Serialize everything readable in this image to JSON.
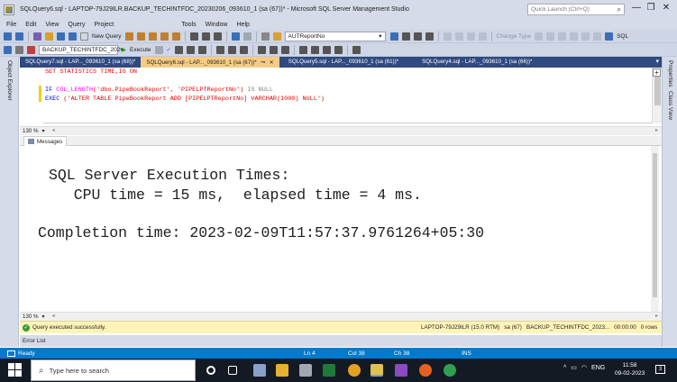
{
  "window": {
    "title": "SQLQuery6.sql - LAPTOP-79J29ILR.BACKUP_TECHINTFDC_20230206_093610_1 (sa (67))* - Microsoft SQL Server Management Studio",
    "quick_launch_placeholder": "Quick Launch (Ctrl+Q)",
    "minimize": "—",
    "maximize": "❐",
    "close": "✕"
  },
  "menu": [
    "File",
    "Edit",
    "View",
    "Query",
    "Project",
    "Tools",
    "Window",
    "Help"
  ],
  "toolbar1": {
    "new_query": "New Query",
    "object_combo": "AUTReportNo",
    "change_type": "Change Type",
    "sql_label": "SQL"
  },
  "toolbar2": {
    "database": "BACKUP_TECHINTFDC_202",
    "execute": "Execute"
  },
  "side": {
    "left": "Object Explorer",
    "right_properties": "Properties",
    "right_class_view": "Class View"
  },
  "tabs": [
    {
      "label": "SQLQuery7.sql - LAP..._093610_1 (sa (68))*",
      "active": false
    },
    {
      "label": "SQLQuery6.sql - LAP..._093610_1 (sa (67))*",
      "active": true
    },
    {
      "label": "SQLQuery5.sql - LAP..._093610_1 (sa (61))*",
      "active": false
    },
    {
      "label": "SQLQuery4.sql - LAP..._093610_1 (sa (66))*",
      "active": false
    }
  ],
  "tab_close": "✕",
  "tab_pin": "⊸",
  "editor": {
    "line1": "SET STATISTICS TIME,IO ON",
    "line3_kw": "IF ",
    "line3_fn": "COL_LENGTH",
    "line3_args": "('dbo.PipeBookReport', 'PIPELPTReportNo')",
    "line3_tail": " IS NULL",
    "line4_kw": "EXEC ",
    "line4_str": "('ALTER TABLE PipeBookReport ADD [PIPELPTReportNo] VARCHAR(1000) NULL')"
  },
  "zoom": "130 %",
  "results_tab": "Messages",
  "messages": {
    "line1": "SQL Server Execution Times:",
    "line2": "   CPU time = 15 ms,  elapsed time = 4 ms.",
    "line3": "Completion time: 2023-02-09T11:57:37.9761264+05:30"
  },
  "query_status": {
    "message": "Query executed successfully.",
    "server": "LAPTOP-79J29ILR (15.0 RTM)",
    "user": "sa (67)",
    "database": "BACKUP_TECHINTFDC_2023...",
    "elapsed": "00:00:00",
    "rows": "0 rows"
  },
  "error_list": "Error List",
  "statusbar": {
    "ready": "Ready",
    "ln": "Ln 4",
    "col": "Col 38",
    "ch": "Ch 38",
    "ins": "INS"
  },
  "taskbar": {
    "search_placeholder": "Type here to search",
    "language": "ENG",
    "time": "11:58",
    "date": "09-02-2023",
    "notification_count": "3"
  },
  "colors": {
    "tab_strip": "#2f4a80",
    "active_tab": "#f5cc84",
    "status_bar": "#007acc",
    "query_success_bar": "#fff4b8"
  }
}
